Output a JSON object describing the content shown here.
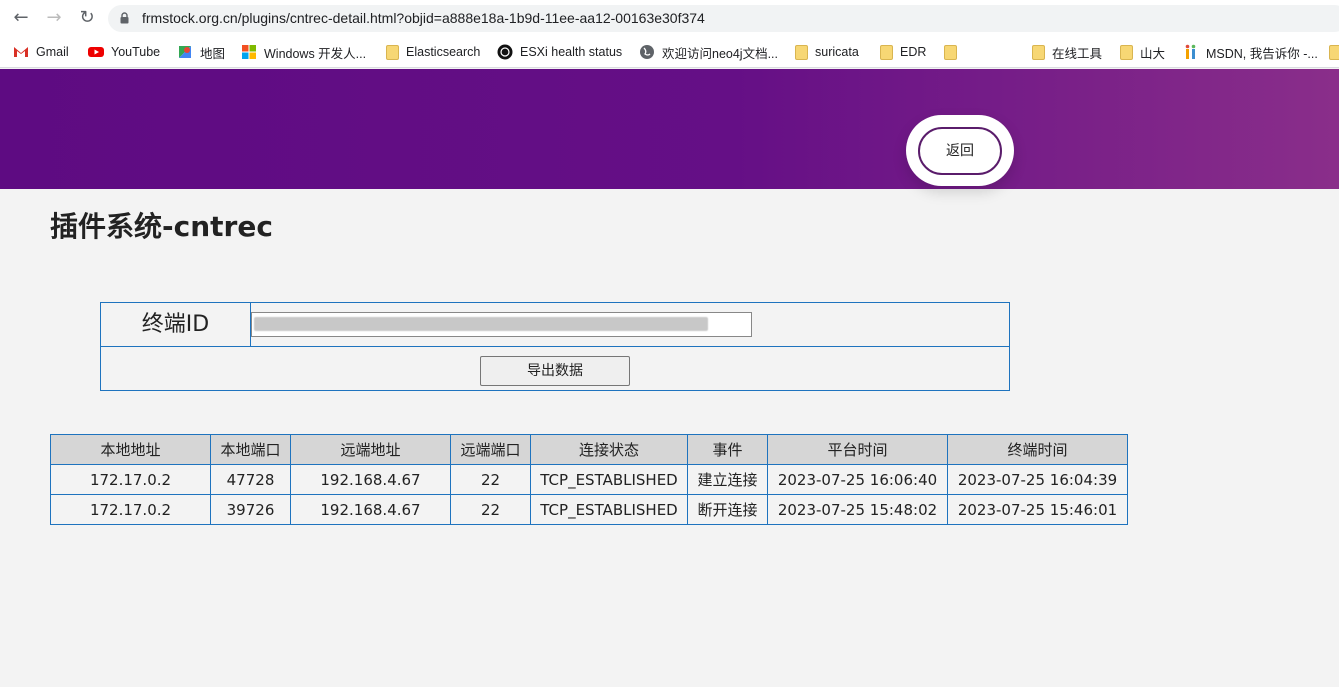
{
  "browser": {
    "url": "frmstock.org.cn/plugins/cntrec-detail.html?objid=a888e18a-1b9d-11ee-aa12-00163e30f374",
    "bookmarks": [
      {
        "label": "Gmail",
        "icon": "gmail-icon"
      },
      {
        "label": "YouTube",
        "icon": "youtube-icon"
      },
      {
        "label": "地图",
        "icon": "maps-icon"
      },
      {
        "label": "Windows 开发人...",
        "icon": "windows-icon"
      },
      {
        "label": "Elasticsearch",
        "icon": "folder-icon"
      },
      {
        "label": "ESXi health status",
        "icon": "esxi-icon"
      },
      {
        "label": "欢迎访问neo4j文档...",
        "icon": "globe-icon"
      },
      {
        "label": "suricata",
        "icon": "folder-icon"
      },
      {
        "label": "EDR",
        "icon": "folder-icon"
      },
      {
        "label": "",
        "icon": "folder-icon"
      },
      {
        "label": "在线工具",
        "icon": "folder-icon"
      },
      {
        "label": "山大",
        "icon": "folder-icon"
      },
      {
        "label": "MSDN, 我告诉你 -...",
        "icon": "msdn-icon"
      }
    ]
  },
  "header": {
    "back_label": "返回"
  },
  "page": {
    "title": "插件系统-cntrec"
  },
  "form": {
    "terminal_label": "终端ID",
    "terminal_value": "",
    "export_label": "导出数据"
  },
  "table": {
    "columns": [
      "本地地址",
      "本地端口",
      "远端地址",
      "远端端口",
      "连接状态",
      "事件",
      "平台时间",
      "终端时间"
    ],
    "rows": [
      [
        "172.17.0.2",
        "47728",
        "192.168.4.67",
        "22",
        "TCP_ESTABLISHED",
        "建立连接",
        "2023-07-25 16:06:40",
        "2023-07-25 16:04:39"
      ],
      [
        "172.17.0.2",
        "39726",
        "192.168.4.67",
        "22",
        "TCP_ESTABLISHED",
        "断开连接",
        "2023-07-25 15:48:02",
        "2023-07-25 15:46:01"
      ]
    ]
  },
  "colors": {
    "header_gradient_start": "#5e0b82",
    "header_gradient_end": "#8a2e8a",
    "table_border": "#1e73be",
    "table_header_bg": "#d6d6d6",
    "back_button_border": "#5a1c6b"
  }
}
